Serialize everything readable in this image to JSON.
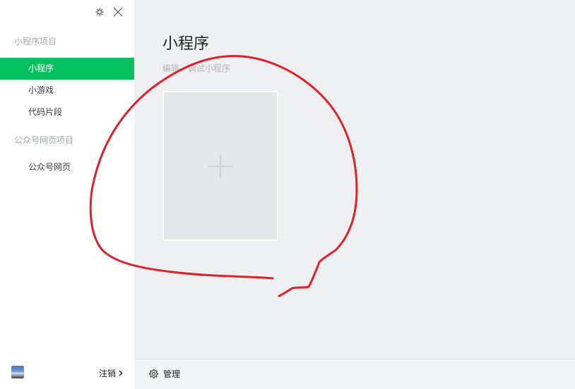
{
  "sidebar": {
    "sections": [
      {
        "title": "小程序项目"
      },
      {
        "title": "公众号网页项目"
      }
    ],
    "items": [
      {
        "label": "小程序"
      },
      {
        "label": "小游戏"
      },
      {
        "label": "代码片段"
      },
      {
        "label": "公众号网页"
      }
    ],
    "footer": {
      "logout_label": "注销",
      "logout_icon": "chevron-right-icon"
    },
    "controls": {
      "settings_icon": "gear-icon",
      "close_icon": "close-icon"
    }
  },
  "main": {
    "title": "小程序",
    "subtitle": "编辑、调试小程序",
    "add_card_icon": "plus-icon",
    "footer": {
      "manage_label": "管理",
      "manage_icon": "gear-icon"
    }
  },
  "colors": {
    "accent": "#07c160",
    "annotation_red": "#e0202a"
  }
}
